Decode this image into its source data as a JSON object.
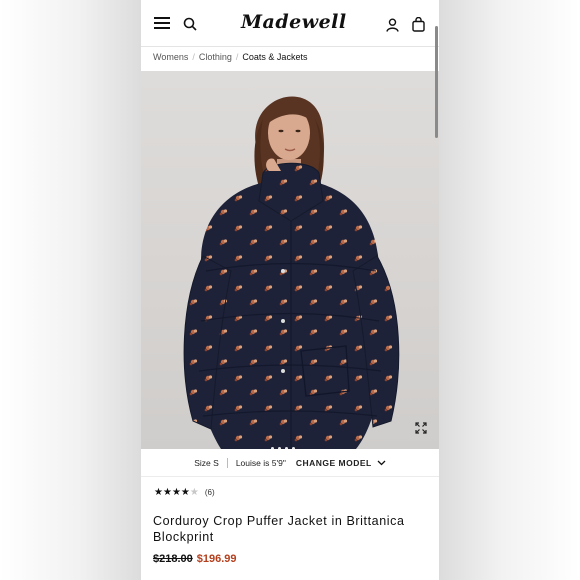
{
  "header": {
    "logo_text": "Madewell",
    "icons": [
      "menu-icon",
      "search-icon",
      "account-icon",
      "bag-icon"
    ]
  },
  "breadcrumb": {
    "items": [
      "Womens",
      "Clothing",
      "Coats & Jackets"
    ]
  },
  "gallery": {
    "slides_total": 4,
    "active_slide": 1
  },
  "model_info": {
    "size_text": "Size S",
    "height_text": "Louise is 5'9\"",
    "change_label": "CHANGE MODEL"
  },
  "product": {
    "rating": 4,
    "rating_max": 5,
    "review_count": "(6)",
    "title": "Corduroy Crop Puffer Jacket in Brittanica Blockprint",
    "price_original": "$218.00",
    "price_sale": "$196.99"
  },
  "colors": {
    "sale_price": "#b4401e",
    "jacket_navy": "#1d2238",
    "print_rust": "#b86a4a"
  }
}
